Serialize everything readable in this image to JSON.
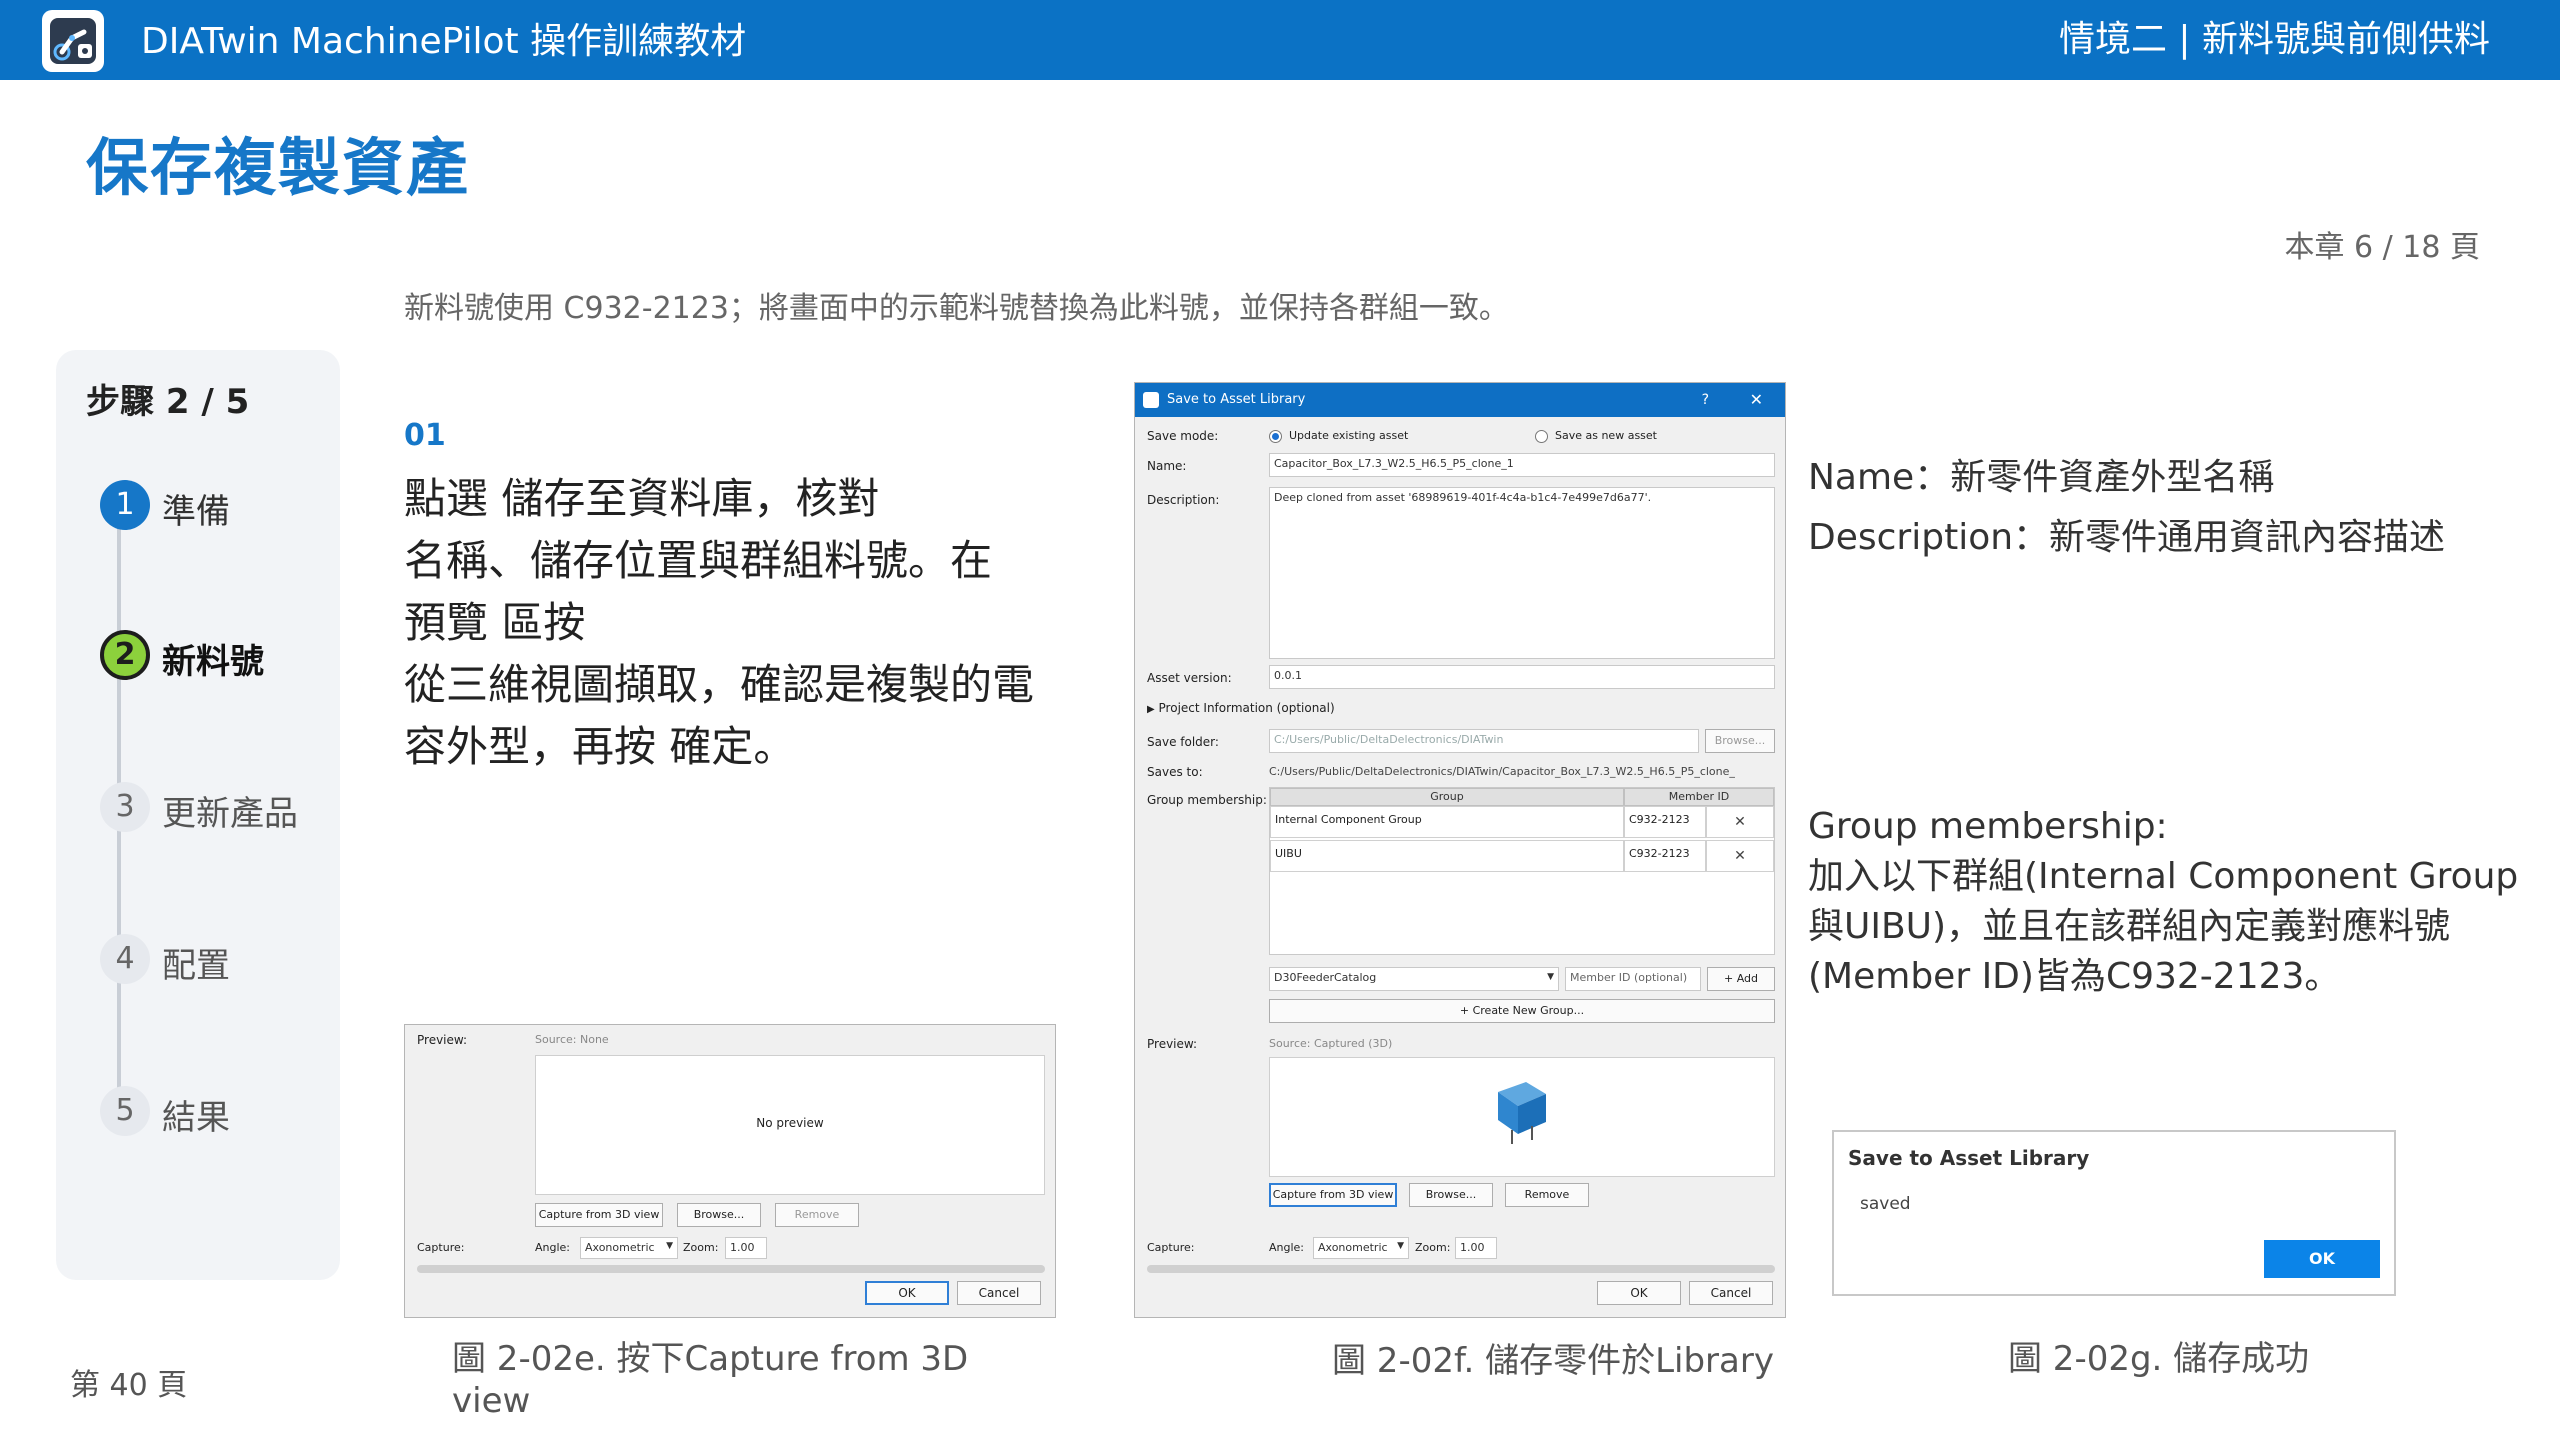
{
  "header": {
    "app_title": "DIATwin MachinePilot 操作訓練教材",
    "chapter_title": "情境二 | 新料號與前側供料"
  },
  "page": {
    "title": "保存複製資產",
    "chapter_page": "本章 6 / 18 頁",
    "intro": "新料號使用 C932-2123；將畫面中的示範料號替換為此料號，並保持各群組一致。",
    "footer_page": "第 40 頁"
  },
  "steps": {
    "label": "步驟 2 / 5",
    "items": [
      {
        "num": "1",
        "label": "準備",
        "state": "done"
      },
      {
        "num": "2",
        "label": "新料號",
        "state": "active"
      },
      {
        "num": "3",
        "label": "更新產品",
        "state": "todo"
      },
      {
        "num": "4",
        "label": "配置",
        "state": "todo"
      },
      {
        "num": "5",
        "label": "結果",
        "state": "todo"
      }
    ]
  },
  "instruction": {
    "step_no": "01",
    "line1": "點選 儲存至資料庫，核對",
    "line2": "名稱、儲存位置與群組料號。在",
    "line3": "預覽 區按",
    "line4": "從三維視圖擷取，確認是複製的電",
    "line5": "容外型，再按 確定。"
  },
  "notes": {
    "name": "Name：新零件資產外型名稱",
    "description": "Description：新零件通用資訊內容描述",
    "group_title": "Group membership:",
    "group_body": "加入以下群組(Internal Component Group與UIBU)，並且在該群組內定義對應料號(Member ID)皆為C932-2123。"
  },
  "captions": {
    "e": "圖 2-02e. 按下Capture from 3D view",
    "f": "圖 2-02f. 儲存零件於Library",
    "g": "圖 2-02g. 儲存成功"
  },
  "dialog_small": {
    "preview_label": "Preview:",
    "source": "Source: None",
    "no_preview": "No preview",
    "capture_btn": "Capture from 3D view",
    "browse_btn": "Browse...",
    "remove_btn": "Remove",
    "capture_label": "Capture:",
    "angle_label": "Angle:",
    "angle_value": "Axonometric",
    "zoom_label": "Zoom:",
    "zoom_value": "1.00",
    "ok": "OK",
    "cancel": "Cancel"
  },
  "dialog_main": {
    "title": "Save to Asset Library",
    "help": "?",
    "close": "✕",
    "save_mode_label": "Save mode:",
    "mode_update": "Update existing asset",
    "mode_new": "Save as new asset",
    "name_label": "Name:",
    "name_value": "Capacitor_Box_L7.3_W2.5_H6.5_P5_clone_1",
    "description_label": "Description:",
    "description_value": "Deep cloned from asset '68989619-401f-4c4a-b1c4-7e499e7d6a77'.",
    "version_label": "Asset version:",
    "version_value": "0.0.1",
    "project_info": "Project Information (optional)",
    "save_folder_label": "Save folder:",
    "save_folder_value": "C:/Users/Public/DeltaDelectronics/DIATwin",
    "browse": "Browse...",
    "saves_to_label": "Saves to:",
    "saves_to_value": "C:/Users/Public/DeltaDelectronics/DIATwin/Capacitor_Box_L7.3_W2.5_H6.5_P5_clone_",
    "group_label": "Group membership:",
    "col_group": "Group",
    "col_member": "Member ID",
    "rows": [
      {
        "group": "Internal Component Group",
        "member": "C932-2123",
        "remove": "✕"
      },
      {
        "group": "UIBU",
        "member": "C932-2123",
        "remove": "✕"
      }
    ],
    "catalog_value": "D30FeederCatalog",
    "member_placeholder": "Member ID (optional)",
    "add_btn": "+ Add",
    "create_group_btn": "+ Create New Group...",
    "preview_label": "Preview:",
    "source": "Source: Captured (3D)",
    "capture_btn": "Capture from 3D view",
    "browse_btn": "Browse...",
    "remove_btn": "Remove",
    "capture_label": "Capture:",
    "angle_label": "Angle:",
    "angle_value": "Axonometric",
    "zoom_label": "Zoom:",
    "zoom_value": "1.00",
    "ok": "OK",
    "cancel": "Cancel"
  },
  "dialog_saved": {
    "title": "Save to Asset Library",
    "message": "saved",
    "ok": "OK"
  },
  "colors": {
    "brand": "#0b72c5",
    "title_blue": "#1677c8",
    "active_step": "#8cd13c"
  }
}
